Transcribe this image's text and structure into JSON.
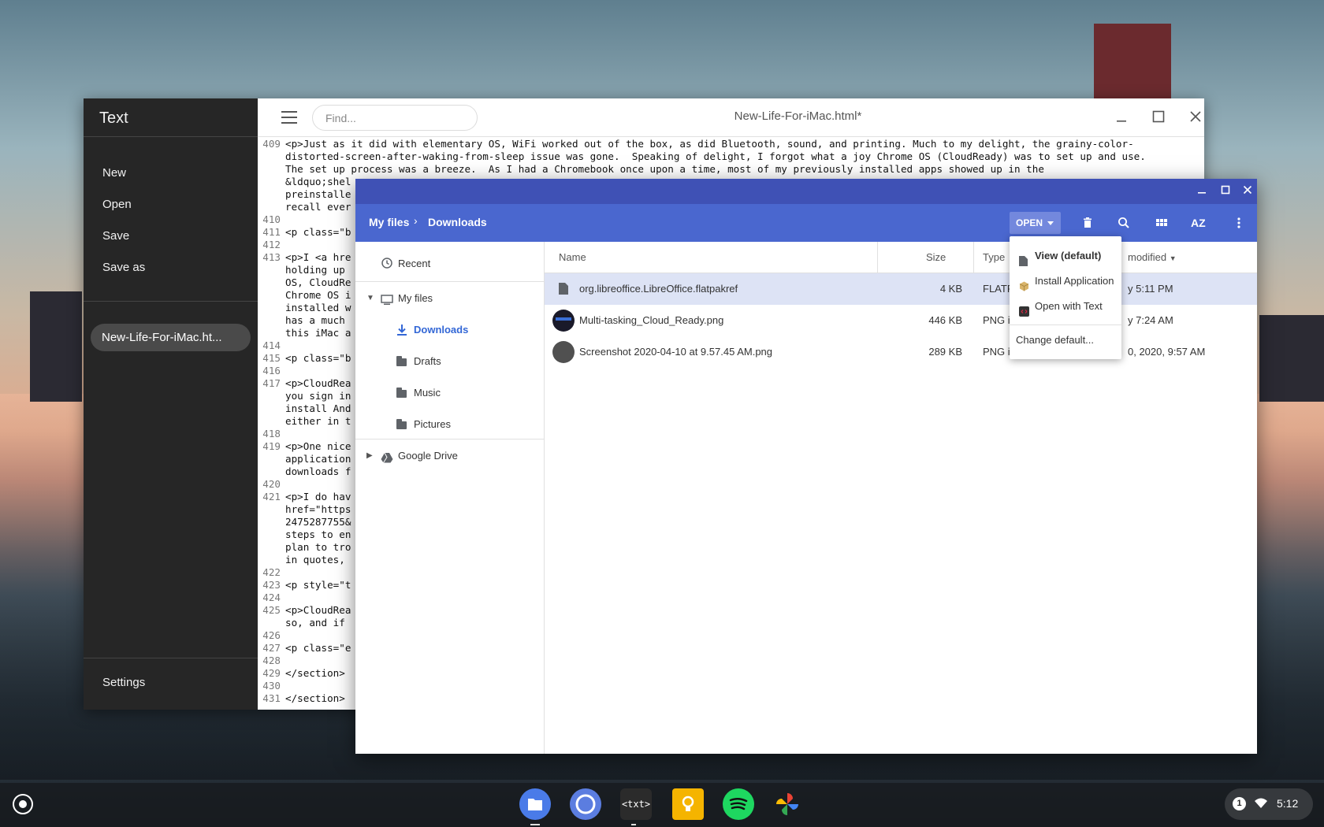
{
  "text_app": {
    "app_title": "Text",
    "menu": [
      "New",
      "Open",
      "Save",
      "Save as"
    ],
    "open_file": "New-Life-For-iMac.ht...",
    "settings_label": "Settings",
    "find_placeholder": "Find...",
    "doc_title": "New-Life-For-iMac.html*",
    "lines": [
      {
        "num": "409",
        "text": "<p>Just as it did with elementary OS, WiFi worked out of the box, as did Bluetooth, sound, and printing. Much to my delight, the grainy-color-"
      },
      {
        "num": "",
        "text": "distorted-screen-after-waking-from-sleep issue was gone.  Speaking of delight, I forgot what a joy Chrome OS (CloudReady) was to set up and use."
      },
      {
        "num": "",
        "text": "The set up process was a breeze.  As I had a Chromebook once upon a time, most of my previously installed apps showed up in the"
      },
      {
        "num": "",
        "text": "&ldquo;shel"
      },
      {
        "num": "",
        "text": "preinstalle"
      },
      {
        "num": "",
        "text": "recall ever"
      },
      {
        "num": "410",
        "text": ""
      },
      {
        "num": "411",
        "text": "<p class=\"b"
      },
      {
        "num": "412",
        "text": ""
      },
      {
        "num": "413",
        "text": "<p>I <a hre"
      },
      {
        "num": "",
        "text": "holding up "
      },
      {
        "num": "",
        "text": "OS, CloudRe"
      },
      {
        "num": "",
        "text": "Chrome OS i"
      },
      {
        "num": "",
        "text": "installed w"
      },
      {
        "num": "",
        "text": "has a much "
      },
      {
        "num": "",
        "text": "this iMac a"
      },
      {
        "num": "414",
        "text": ""
      },
      {
        "num": "415",
        "text": "<p class=\"b"
      },
      {
        "num": "416",
        "text": ""
      },
      {
        "num": "417",
        "text": "<p>CloudRea"
      },
      {
        "num": "",
        "text": "you sign in"
      },
      {
        "num": "",
        "text": "install And"
      },
      {
        "num": "",
        "text": "either in t"
      },
      {
        "num": "418",
        "text": ""
      },
      {
        "num": "419",
        "text": "<p>One nice"
      },
      {
        "num": "",
        "text": "application"
      },
      {
        "num": "",
        "text": "downloads f"
      },
      {
        "num": "420",
        "text": ""
      },
      {
        "num": "421",
        "text": "<p>I do hav"
      },
      {
        "num": "",
        "text": "href=\"https"
      },
      {
        "num": "",
        "text": "2475287755&"
      },
      {
        "num": "",
        "text": "steps to en"
      },
      {
        "num": "",
        "text": "plan to tro"
      },
      {
        "num": "",
        "text": "in quotes, "
      },
      {
        "num": "422",
        "text": ""
      },
      {
        "num": "423",
        "text": "<p style=\"t"
      },
      {
        "num": "424",
        "text": ""
      },
      {
        "num": "425",
        "text": "<p>CloudRea"
      },
      {
        "num": "",
        "text": "so, and if "
      },
      {
        "num": "426",
        "text": ""
      },
      {
        "num": "427",
        "text": "<p class=\"e"
      },
      {
        "num": "428",
        "text": ""
      },
      {
        "num": "429",
        "text": "</section>"
      },
      {
        "num": "430",
        "text": ""
      },
      {
        "num": "431",
        "text": "</section>"
      }
    ]
  },
  "files_app": {
    "breadcrumb": [
      "My files",
      "Downloads"
    ],
    "open_button": "OPEN",
    "toolbar_icons": [
      "delete-icon",
      "search-icon",
      "grid-view-icon",
      "sort-icon",
      "more-vert-icon"
    ],
    "sort_label": "AZ",
    "nav": {
      "recent": "Recent",
      "my_files": "My files",
      "folders": [
        "Downloads",
        "Drafts",
        "Music",
        "Pictures"
      ],
      "google_drive": "Google Drive"
    },
    "columns": {
      "name": "Name",
      "size": "Size",
      "type": "Type",
      "modified": "modified"
    },
    "files": [
      {
        "name": "org.libreoffice.LibreOffice.flatpakref",
        "size": "4 KB",
        "type": "FLATPA",
        "date": "y 5:11 PM",
        "selected": true
      },
      {
        "name": "Multi-tasking_Cloud_Ready.png",
        "size": "446 KB",
        "type": "PNG im",
        "date": "y 7:24 AM",
        "selected": false
      },
      {
        "name": "Screenshot 2020-04-10 at 9.57.45 AM.png",
        "size": "289 KB",
        "type": "PNG im",
        "date": "0, 2020, 9:57 AM",
        "selected": false
      }
    ],
    "open_menu": {
      "items": [
        "View (default)",
        "Install Application",
        "Open with Text"
      ],
      "change_default": "Change default..."
    }
  },
  "shelf": {
    "apps": [
      "files-icon",
      "chromium-icon",
      "text-icon",
      "keep-icon",
      "spotify-icon",
      "photos-icon"
    ],
    "text_app_glyph": "<txt>",
    "notification_count": "1",
    "time": "5:12"
  },
  "colors": {
    "files_titlebar": "#3f51b5",
    "files_header": "#4a67cf",
    "selection": "#dde3f5",
    "accent": "#3367d6"
  }
}
